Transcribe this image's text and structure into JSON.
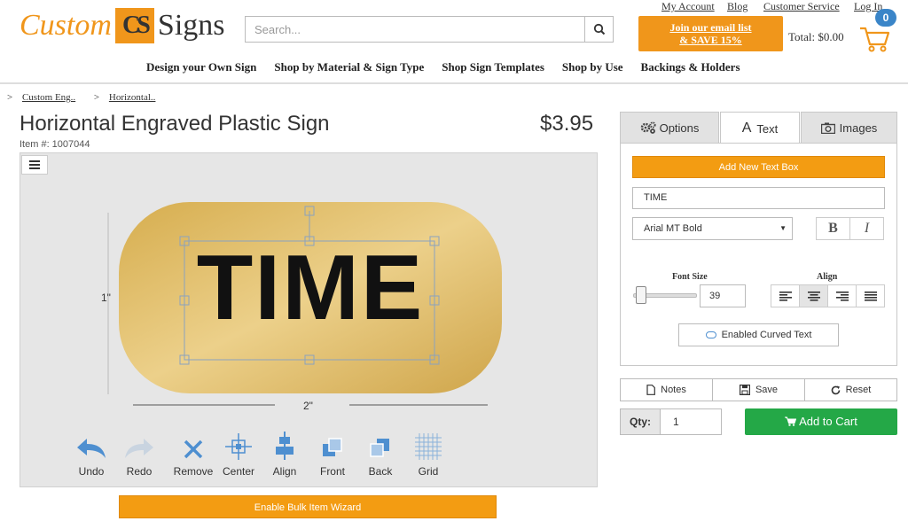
{
  "header": {
    "logo": {
      "word1": "Custom",
      "mark": "CS",
      "word2": "Signs"
    },
    "search": {
      "placeholder": "Search..."
    },
    "top_links": [
      "My Account",
      "Blog",
      "Customer Service",
      "Log In"
    ],
    "join": {
      "line1": "Join our email list",
      "line2": "& SAVE 15%"
    },
    "total": "Total: $0.00",
    "cart_count": "0"
  },
  "nav": [
    "Design your Own Sign",
    "Shop by Material & Sign Type",
    "Shop Sign Templates",
    "Shop by Use",
    "Backings & Holders"
  ],
  "breadcrumb": [
    "Custom Eng..",
    "Horizontal.."
  ],
  "product": {
    "title": "Horizontal Engraved Plastic Sign",
    "item_no": "Item #: 1007044",
    "price": "$3.95"
  },
  "editor": {
    "sign_text": "TIME",
    "height_label": "1\"",
    "width_label": "2\"",
    "tools": [
      "Undo",
      "Redo",
      "Remove",
      "Center",
      "Align",
      "Front",
      "Back",
      "Grid"
    ],
    "bulk_button": "Enable Bulk Item Wizard"
  },
  "panel": {
    "tabs": [
      "Options",
      "Text",
      "Images"
    ],
    "active_tab": "Text",
    "add_text_box": "Add New Text Box",
    "text_value": "TIME",
    "font": "Arial MT Bold",
    "bold_label": "B",
    "italic_label": "I",
    "font_size_label": "Font Size",
    "font_size": "39",
    "align_label": "Align",
    "curved_text": "Enabled Curved Text",
    "notes": "Notes",
    "save": "Save",
    "reset": "Reset",
    "qty_label": "Qty:",
    "qty": "1",
    "add_to_cart": "Add to Cart"
  },
  "colors": {
    "accent": "#f39c12",
    "green": "#24a847",
    "blue": "#3a85c8",
    "gold": "#d9b35a"
  }
}
